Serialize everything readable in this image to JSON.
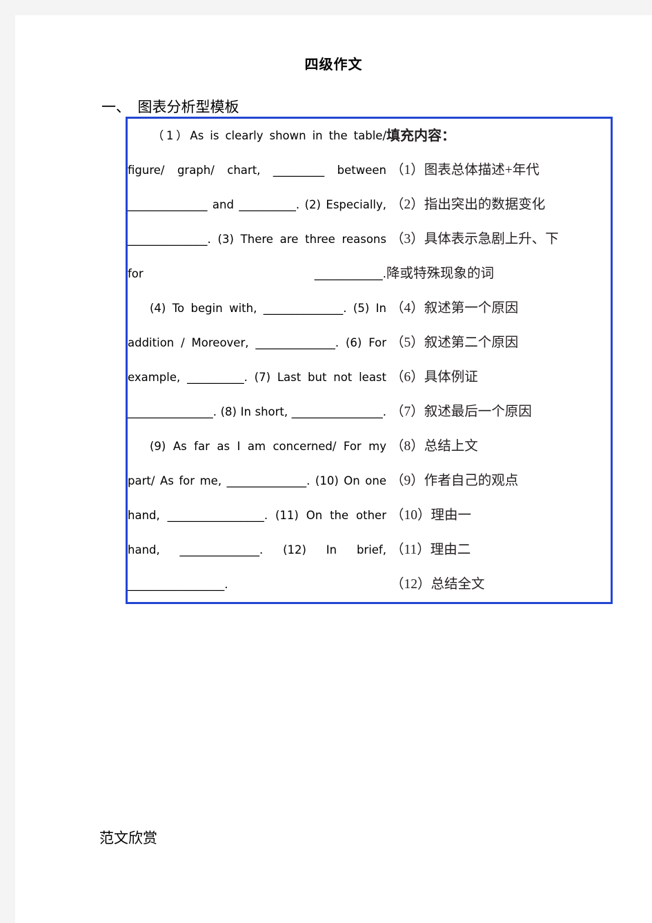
{
  "document": {
    "title": "四级作文",
    "section_heading": "一、  图表分析型模板",
    "footer_note": "范文欣赏"
  },
  "table": {
    "left_column": {
      "paragraphs": [
        "（1）As is clearly shown in the table/ figure/ graph/ chart, _________ between ______________ and __________. (2) Especially, ______________. (3) There are three reasons for ____________.",
        "(4) To begin with, ______________. (5) In addition / Moreover, ______________. (6) For example, __________. (7) Last but not least _______________. (8) In short, ________________.",
        "(9) As far as I am concerned/ For my part/ As for me, ______________. (10) On one hand, _________________. (11) On the other hand, ______________. (12) In brief, _________________."
      ],
      "lines": [
        "（1）As is clearly shown in the",
        "table/ figure/ graph/ chart,",
        "_________ between",
        "______________ and",
        "__________. (2) Especially,",
        "______________. (3) There are",
        "three reasons for ____________.",
        "(4) To begin with,",
        "______________. (5) In addition /",
        "Moreover, ______________. (6)",
        "For example, __________. (7) Last",
        "but not least _______________.",
        "(8) In short, ________________.",
        "(9) As far as I am concerned/",
        "For my part/ As for me,",
        "______________. (10) On one",
        "hand, _________________. (11)",
        "On the other hand,",
        "______________. (12) In brief,",
        "_________________."
      ]
    },
    "right_column": {
      "heading": "填充内容：",
      "items": [
        "（1）图表总体描述+年代",
        "（2）指出突出的数据变化",
        "（3）具体表示急剧上升、下",
        "降或特殊现象的词",
        "（4）叙述第一个原因",
        "（5）叙述第二个原因",
        "（6）具体例证",
        "（7）叙述最后一个原因",
        "（8）总结上文",
        "（9）作者自己的观点",
        "（10）理由一",
        "（11）理由二",
        "（12）总结全文"
      ]
    }
  },
  "colors": {
    "table_border": "#2346d4",
    "page_background": "#ffffff",
    "canvas_background": "#f4f4f4",
    "text": "#000000"
  }
}
